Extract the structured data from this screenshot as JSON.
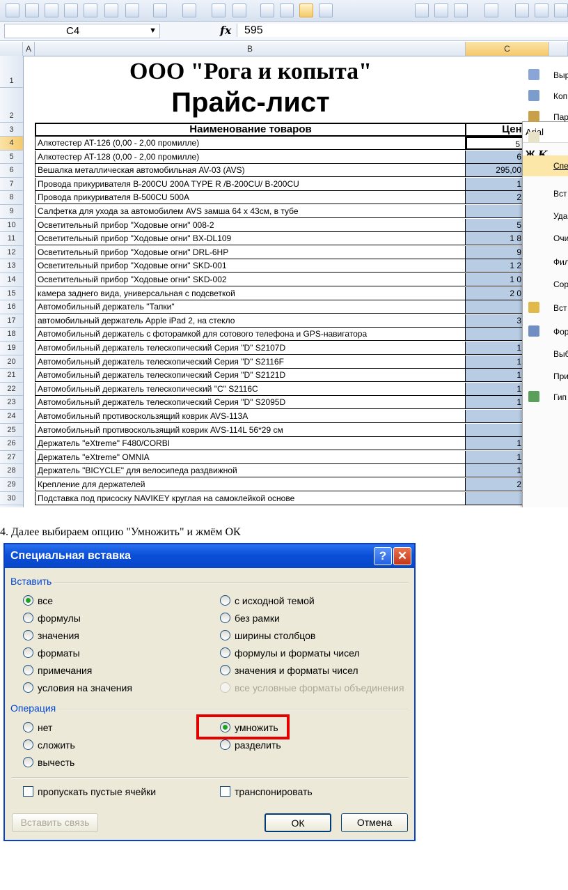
{
  "sheet": {
    "name_box": "C4",
    "fx_label": "fx",
    "formula_value": "595",
    "col_headers": [
      "A",
      "B",
      "C"
    ],
    "row_numbers": [
      "1",
      "2",
      "3",
      "4",
      "5",
      "6",
      "7",
      "8",
      "9",
      "10",
      "11",
      "12",
      "13",
      "14",
      "15",
      "16",
      "17",
      "18",
      "19",
      "20",
      "21",
      "22",
      "23",
      "24",
      "25",
      "26",
      "27",
      "28",
      "29",
      "30"
    ],
    "title1": "ООО \"Рога и копыта\"",
    "title2": "Прайс-лист",
    "header_name": "Наименование товаров",
    "header_price": "Цена",
    "rows": [
      {
        "name": "Алкотестер AT-126 (0,00 - 2,00 промилле)",
        "price": "5"
      },
      {
        "name": "Алкотестер AT-128 (0,00 - 2,00 промилле)",
        "price": "6"
      },
      {
        "name": "Вешалка металлическая автомобильная AV-03 (AVS)",
        "price": "295,00"
      },
      {
        "name": "Провода прикуривателя B-200CU 200A TYPE R /B-200CU/ B-200CU",
        "price": "1"
      },
      {
        "name": "Провода прикуривателя B-500CU 500A",
        "price": "2"
      },
      {
        "name": "Салфетка для ухода за автомобилем AVS замша 64 x 43см, в тубе",
        "price": ""
      },
      {
        "name": "Осветительный прибор \"Ходовые огни\" 008-2",
        "price": "5"
      },
      {
        "name": "Осветительный прибор \"Ходовые огни\" BX-DL109",
        "price": "1 8"
      },
      {
        "name": "Осветительный прибор \"Ходовые огни\" DRL-6HP",
        "price": "9"
      },
      {
        "name": "Осветительный прибор \"Ходовые огни\" SKD-001",
        "price": "1 2"
      },
      {
        "name": "Осветительный прибор \"Ходовые огни\" SKD-002",
        "price": "1 0"
      },
      {
        "name": "камера заднего вида, универсальная с подсветкой",
        "price": "2 0"
      },
      {
        "name": "Автомобильный держатель \"Тапки\"",
        "price": ""
      },
      {
        "name": "автомобильный держатель Apple iPad 2, на стекло",
        "price": "3"
      },
      {
        "name": "Автомобильный держатель с фоторамкой для сотового телефона и GPS-навигатора",
        "price": ""
      },
      {
        "name": "Автомобильный держатель телескопический Серия  \"D\" S2107D",
        "price": "1"
      },
      {
        "name": "Автомобильный держатель телескопический Серия  \"D\" S2116F",
        "price": "1"
      },
      {
        "name": "Автомобильный держатель телескопический Серия  \"D\" S2121D",
        "price": "1"
      },
      {
        "name": "Автомобильный держатель телескопический  \"С\" S2116C",
        "price": "1"
      },
      {
        "name": "Автомобильный держатель телескопический Серия \"D\" S2095D",
        "price": "1"
      },
      {
        "name": "Автомобильный противоскользящий коврик AVS-113A",
        "price": ""
      },
      {
        "name": "Автомобильный противоскользящий коврик AVS-114L 56*29 см",
        "price": ""
      },
      {
        "name": "Держатель  \"eXtreme\" F480/CORBI",
        "price": "1"
      },
      {
        "name": "Держатель  \"eXtreme\" OMNIA",
        "price": "1"
      },
      {
        "name": "Держатель \"BICYCLE\" для велосипеда раздвижной",
        "price": "1"
      },
      {
        "name": "Крепление для держателей",
        "price": "2"
      },
      {
        "name": "Подставка под присоску NAVIKEY круглая на самоклейкой основе",
        "price": ""
      }
    ]
  },
  "context_menu": {
    "font_name": "Arial",
    "bold_label": "Ж",
    "italic_label": "К",
    "items": [
      "Выр",
      "Коп",
      "Пар",
      "",
      "Спе",
      "Вст",
      "Уда",
      "Очи",
      "Фил",
      "Сор",
      "Вст",
      "Фор",
      "Выб",
      "При",
      "Гип"
    ]
  },
  "caption": "4. Далее выбираем опцию \"Умножить\" и жмём ОК",
  "dialog": {
    "title": "Специальная вставка",
    "help_label": "?",
    "close_label": "✕",
    "paste_group": "Вставить",
    "paste_left": [
      "все",
      "формулы",
      "значения",
      "форматы",
      "примечания",
      "условия на значения"
    ],
    "paste_right": [
      "с исходной темой",
      "без рамки",
      "ширины столбцов",
      "формулы и форматы чисел",
      "значения и форматы чисел",
      "все условные форматы объединения"
    ],
    "operation_group": "Операция",
    "op_left": [
      "нет",
      "сложить",
      "вычесть"
    ],
    "op_right": [
      "умножить",
      "разделить"
    ],
    "skip_blanks": "пропускать пустые ячейки",
    "transpose": "транспонировать",
    "paste_link": "Вставить связь",
    "ok": "ОК",
    "cancel": "Отмена"
  }
}
